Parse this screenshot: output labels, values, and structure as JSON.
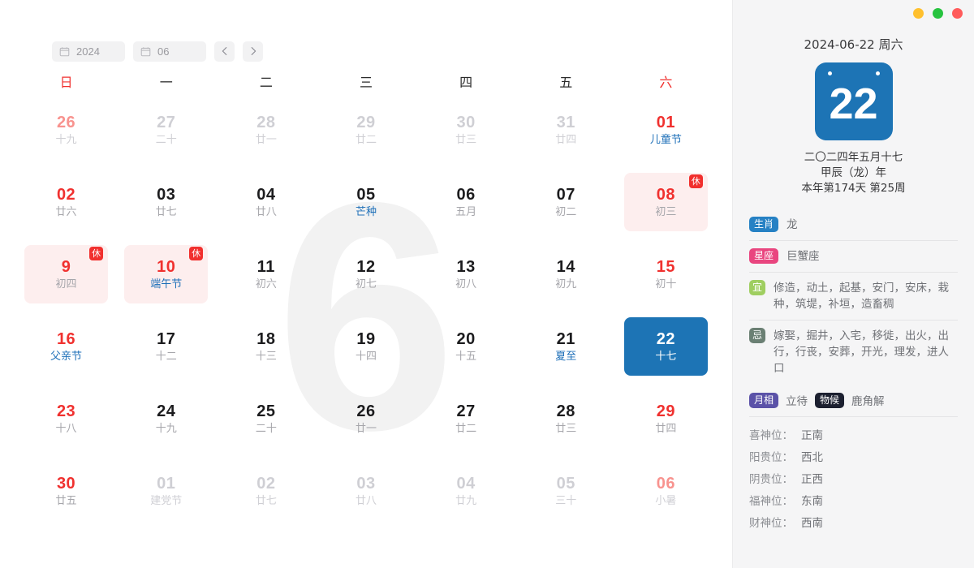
{
  "toolbar": {
    "year": "2024",
    "month": "06",
    "year_icon": "calendar-icon",
    "month_icon": "calendar-icon",
    "prev_label": "‹",
    "next_label": "›"
  },
  "watermark": "6",
  "weekdays": [
    {
      "label": "日",
      "weekend": true
    },
    {
      "label": "一",
      "weekend": false
    },
    {
      "label": "二",
      "weekend": false
    },
    {
      "label": "三",
      "weekend": false
    },
    {
      "label": "四",
      "weekend": false
    },
    {
      "label": "五",
      "weekend": false
    },
    {
      "label": "六",
      "weekend": true
    }
  ],
  "weeks": [
    [
      {
        "day": "26",
        "sub": "十九",
        "out": true,
        "red": true
      },
      {
        "day": "27",
        "sub": "二十",
        "out": true
      },
      {
        "day": "28",
        "sub": "廿一",
        "out": true
      },
      {
        "day": "29",
        "sub": "廿二",
        "out": true
      },
      {
        "day": "30",
        "sub": "廿三",
        "out": true
      },
      {
        "day": "31",
        "sub": "廿四",
        "out": true
      },
      {
        "day": "01",
        "sub": "儿童节",
        "red": true,
        "term": true
      }
    ],
    [
      {
        "day": "02",
        "sub": "廿六",
        "red": true
      },
      {
        "day": "03",
        "sub": "廿七"
      },
      {
        "day": "04",
        "sub": "廿八"
      },
      {
        "day": "05",
        "sub": "芒种",
        "term": true
      },
      {
        "day": "06",
        "sub": "五月"
      },
      {
        "day": "07",
        "sub": "初二"
      },
      {
        "day": "08",
        "sub": "初三",
        "red": true,
        "rest": true,
        "rest_label": "休"
      }
    ],
    [
      {
        "day": "9",
        "sub": "初四",
        "red": true,
        "rest": true,
        "rest_label": "休"
      },
      {
        "day": "10",
        "sub": "端午节",
        "red": true,
        "rest": true,
        "rest_label": "休",
        "term": true
      },
      {
        "day": "11",
        "sub": "初六"
      },
      {
        "day": "12",
        "sub": "初七"
      },
      {
        "day": "13",
        "sub": "初八"
      },
      {
        "day": "14",
        "sub": "初九"
      },
      {
        "day": "15",
        "sub": "初十",
        "red": true
      }
    ],
    [
      {
        "day": "16",
        "sub": "父亲节",
        "red": true,
        "term": true
      },
      {
        "day": "17",
        "sub": "十二"
      },
      {
        "day": "18",
        "sub": "十三"
      },
      {
        "day": "19",
        "sub": "十四"
      },
      {
        "day": "20",
        "sub": "十五"
      },
      {
        "day": "21",
        "sub": "夏至",
        "term": true
      },
      {
        "day": "22",
        "sub": "十七",
        "selected": true
      }
    ],
    [
      {
        "day": "23",
        "sub": "十八",
        "red": true
      },
      {
        "day": "24",
        "sub": "十九"
      },
      {
        "day": "25",
        "sub": "二十"
      },
      {
        "day": "26",
        "sub": "廿一"
      },
      {
        "day": "27",
        "sub": "廿二"
      },
      {
        "day": "28",
        "sub": "廿三"
      },
      {
        "day": "29",
        "sub": "廿四",
        "red": true
      }
    ],
    [
      {
        "day": "30",
        "sub": "廿五",
        "red": true
      },
      {
        "day": "01",
        "sub": "建党节",
        "out": true,
        "term": true
      },
      {
        "day": "02",
        "sub": "廿七",
        "out": true
      },
      {
        "day": "03",
        "sub": "廿八",
        "out": true
      },
      {
        "day": "04",
        "sub": "廿九",
        "out": true
      },
      {
        "day": "05",
        "sub": "三十",
        "out": true
      },
      {
        "day": "06",
        "sub": "小暑",
        "out": true,
        "red": true,
        "term": true
      }
    ]
  ],
  "window_dots": [
    {
      "name": "minimize-dot",
      "color": "#ffc02e"
    },
    {
      "name": "maximize-dot",
      "color": "#27c33f"
    },
    {
      "name": "close-dot",
      "color": "#ff5b5b"
    }
  ],
  "detail": {
    "date_line": "2024-06-22 周六",
    "big_day": "22",
    "lunar_date": "二〇二四年五月十七",
    "ganzhi_year": "甲辰（龙）年",
    "day_of_year": "本年第174天 第25周",
    "rows": [
      {
        "tag": "生肖",
        "tag_color": "#2681c4",
        "square": false,
        "text": "龙"
      },
      {
        "tag": "星座",
        "tag_color": "#e9457f",
        "square": false,
        "text": "巨蟹座"
      },
      {
        "tag": "宜",
        "tag_color": "#9fce60",
        "square": true,
        "text": "修造，动土，起基，安门，安床，栽种，筑堤，补垣，造畜稠"
      },
      {
        "tag": "忌",
        "tag_color": "#6b8074",
        "square": true,
        "text": "嫁娶，掘井，入宅，移徙，出火，出行，行丧，安葬，开光，理发，进人口"
      }
    ],
    "phase": [
      {
        "tag": "月相",
        "tag_color": "#5b52a8",
        "value": "立待"
      },
      {
        "tag": "物候",
        "tag_color": "#1c2030",
        "value": "鹿角解"
      }
    ],
    "positions": [
      {
        "label": "喜神位：",
        "value": "正南"
      },
      {
        "label": "阳贵位：",
        "value": "西北"
      },
      {
        "label": "阴贵位：",
        "value": "正西"
      },
      {
        "label": "福神位：",
        "value": "东南"
      },
      {
        "label": "财神位：",
        "value": "西南"
      }
    ]
  }
}
